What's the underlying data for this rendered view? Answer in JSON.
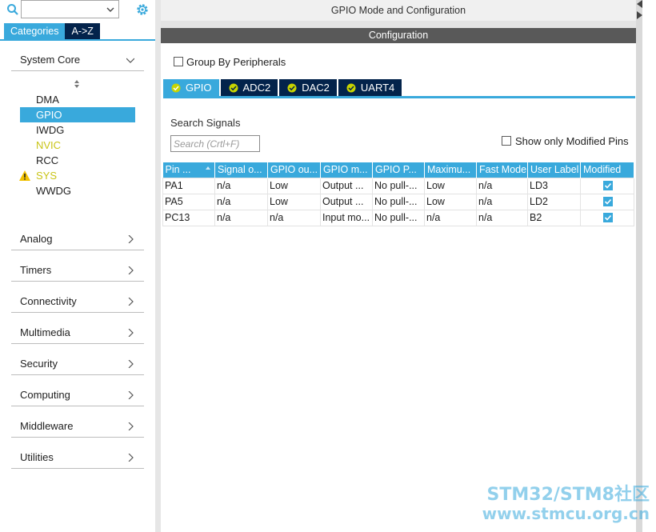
{
  "left_panel": {
    "search": {
      "placeholder": ""
    },
    "tabs": {
      "categories": "Categories",
      "az": "A->Z"
    },
    "system_core": {
      "label": "System Core",
      "items": [
        {
          "label": "DMA"
        },
        {
          "label": "GPIO"
        },
        {
          "label": "IWDG"
        },
        {
          "label": "NVIC"
        },
        {
          "label": "RCC"
        },
        {
          "label": "SYS"
        },
        {
          "label": "WWDG"
        }
      ]
    },
    "categories": [
      {
        "label": "Analog"
      },
      {
        "label": "Timers"
      },
      {
        "label": "Connectivity"
      },
      {
        "label": "Multimedia"
      },
      {
        "label": "Security"
      },
      {
        "label": "Computing"
      },
      {
        "label": "Middleware"
      },
      {
        "label": "Utilities"
      }
    ]
  },
  "main": {
    "mode_title": "GPIO Mode and Configuration",
    "config_title": "Configuration",
    "group_by_label": "Group By Peripherals",
    "peripheral_tabs": [
      {
        "label": "GPIO"
      },
      {
        "label": "ADC2"
      },
      {
        "label": "DAC2"
      },
      {
        "label": "UART4"
      }
    ],
    "search_signals_label": "Search Signals",
    "search_signals_placeholder": "Search (Crtl+F)",
    "show_modified_label": "Show only Modified Pins",
    "table": {
      "headers": [
        "Pin ...",
        "Signal o...",
        "GPIO ou...",
        "GPIO m...",
        "GPIO P...",
        "Maximu...",
        "Fast Mode",
        "User Label",
        "Modified"
      ],
      "rows": [
        [
          "PA1",
          "n/a",
          "Low",
          "Output ...",
          "No pull-...",
          "Low",
          "n/a",
          "LD3",
          true
        ],
        [
          "PA5",
          "n/a",
          "Low",
          "Output ...",
          "No pull-...",
          "Low",
          "n/a",
          "LD2",
          true
        ],
        [
          "PC13",
          "n/a",
          "n/a",
          "Input mo...",
          "No pull-...",
          "n/a",
          "n/a",
          "B2",
          true
        ]
      ]
    }
  },
  "watermark": {
    "line1": "STM32/STM8社区",
    "line2": "www.stmcu.org.cn"
  },
  "colors": {
    "accent": "#39a9dc",
    "dark_tab": "#03234b",
    "config_bar": "#595959",
    "nvic_sys": "#c9c416"
  }
}
